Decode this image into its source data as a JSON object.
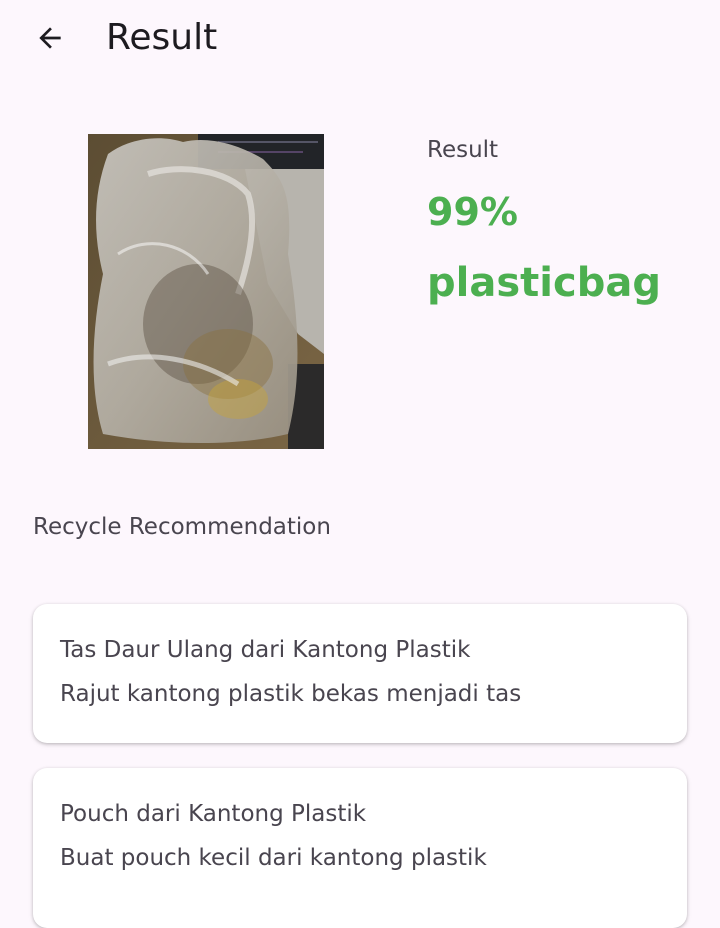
{
  "header": {
    "title": "Result",
    "back_icon": "arrow-back-icon"
  },
  "result": {
    "label": "Result",
    "confidence": "99%",
    "class_name": "plasticbag"
  },
  "recommendation": {
    "section_title": "Recycle Recommendation",
    "items": [
      {
        "title": "Tas Daur Ulang dari Kantong Plastik",
        "description": "Rajut kantong plastik bekas menjadi tas"
      },
      {
        "title": "Pouch dari Kantong Plastik",
        "description": "Buat pouch kecil dari kantong plastik"
      }
    ]
  },
  "colors": {
    "accent": "#4caf50",
    "background": "#fdf7fd",
    "text": "#49454f"
  }
}
